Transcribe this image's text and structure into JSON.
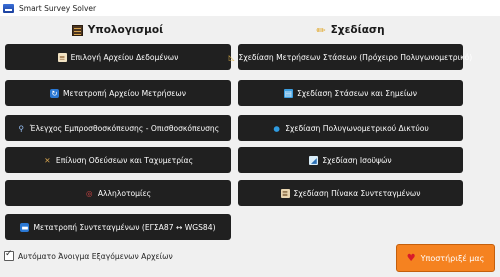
{
  "window": {
    "title": "Smart Survey Solver",
    "icon": "app-icon"
  },
  "columns": {
    "left": {
      "title": "Υπολογισμοί",
      "icon": "abacus-icon"
    },
    "right": {
      "title": "Σχεδίαση",
      "icon": "pencil-icon"
    }
  },
  "left_buttons": [
    {
      "label": "Επιλογή Αρχείου Δεδομένων",
      "icon": "document-icon"
    },
    {
      "label": "Μετατροπή Αρχείου Μετρήσεων",
      "icon": "refresh-icon"
    },
    {
      "label": "Έλεγχος Εμπροσθοσκόπευσης - Οπισθοσκόπευσης",
      "icon": "magnifier-icon"
    },
    {
      "label": "Επίλυση Οδεύσεων και Ταχυμετρίας",
      "icon": "tools-icon"
    },
    {
      "label": "Αλληλοτομίες",
      "icon": "target-icon"
    },
    {
      "label": "Μετατροπή Συντεταγμένων (ΕΓΣΑ87 ↔ WGS84)",
      "icon": "swap-icon"
    }
  ],
  "right_buttons": [
    {
      "label": "Σχεδίαση Μετρήσεων Στάσεων (Πρόχειρο Πολυγωνομετρικό)",
      "icon": "triangle-ruler-icon"
    },
    {
      "label": "Σχεδίαση Στάσεων και Σημείων",
      "icon": "map-icon"
    },
    {
      "label": "Σχεδίαση Πολυγωνομετρικού Δικτύου",
      "icon": "globe-icon"
    },
    {
      "label": "Σχεδίαση Ισοϋψών",
      "icon": "contour-chart-icon"
    },
    {
      "label": "Σχεδίαση Πίνακα Συντεταγμένων",
      "icon": "clipboard-icon"
    }
  ],
  "auto_open": {
    "label": "Αυτόματο Άνοιγμα Εξαγόμενων Αρχείων",
    "checked": true
  },
  "support": {
    "label": "Υποστήριξέ μας",
    "icon": "heart-icon"
  },
  "colors": {
    "button_bg": "#202020",
    "support_bg": "#f58220",
    "window_bg": "#f0f0f0"
  }
}
